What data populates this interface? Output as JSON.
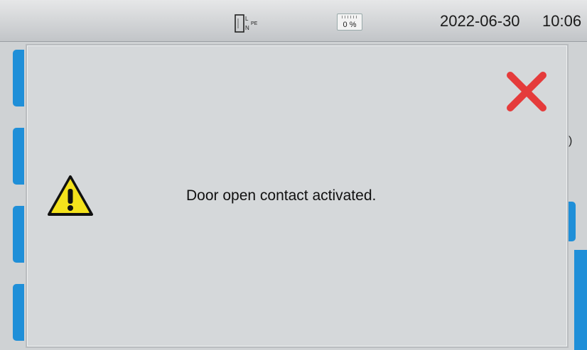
{
  "status_bar": {
    "connection_icon": "L-N-PE-plug-icon",
    "connection_labels": {
      "l": "L",
      "n": "N",
      "pe": "PE"
    },
    "battery_icon": "battery-icon",
    "battery_level": "0 %",
    "date": "2022-06-30",
    "time": "10:06"
  },
  "background": {
    "edge_glyph": ")"
  },
  "dialog": {
    "message": "Door open contact activated.",
    "warning_icon": "warning-icon",
    "close_icon": "close-icon",
    "colors": {
      "close": "#e53b3b",
      "warning": "#f4e21c",
      "accent": "#1f8fd8"
    }
  }
}
